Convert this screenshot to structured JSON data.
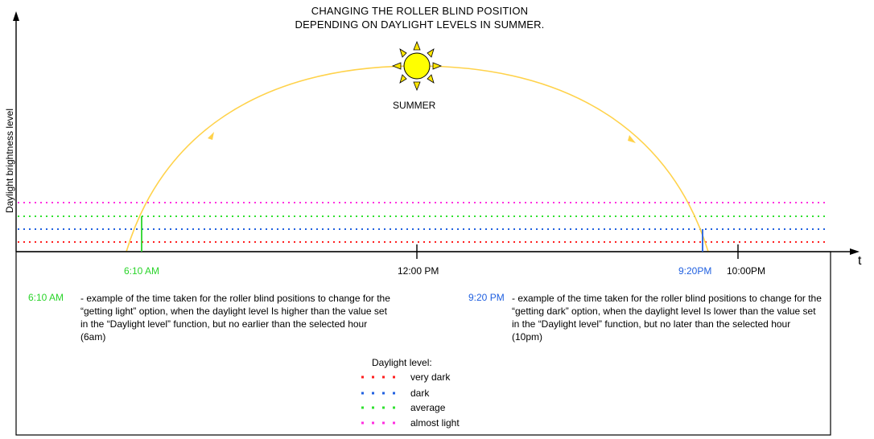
{
  "title_line1": "CHANGING THE ROLLER BLIND POSITION",
  "title_line2": "DEPENDING ON DAYLIGHT LEVELS IN SUMMER.",
  "y_axis_label": "Daylight brightness level",
  "x_axis_label": "t",
  "season_label": "SUMMER",
  "sun_icon": "sun-icon",
  "ticks": {
    "morning": "6:10 AM",
    "noon": "12:00 PM",
    "evening": "9:20PM",
    "limit": "10:00PM"
  },
  "notes": {
    "morning_time": "6:10 AM",
    "morning_text": "- example of the time taken for the roller blind positions to change for the “getting light” option, when the daylight level Is higher than the value set in the “Daylight level” function, but no earlier than the selected hour (6am)",
    "evening_time": "9:20 PM",
    "evening_text": "- example of the time taken for the roller blind positions to change for the “getting dark” option, when the daylight level Is lower than the value set in the “Daylight level” function, but no later than the selected hour (10pm)"
  },
  "legend": {
    "title": "Daylight level:",
    "items": [
      {
        "label": "very dark",
        "color": "#ff2020"
      },
      {
        "label": "dark",
        "color": "#2060e0"
      },
      {
        "label": "average",
        "color": "#30e030"
      },
      {
        "label": "almost light",
        "color": "#ff30e0"
      }
    ]
  },
  "colors": {
    "sun_path": "#ffd24a",
    "sun_fill": "#ffff00",
    "morning_marker": "#2ad42a",
    "evening_marker": "#2060e0",
    "morning_text": "#2ad42a",
    "evening_text": "#2060e0"
  }
}
